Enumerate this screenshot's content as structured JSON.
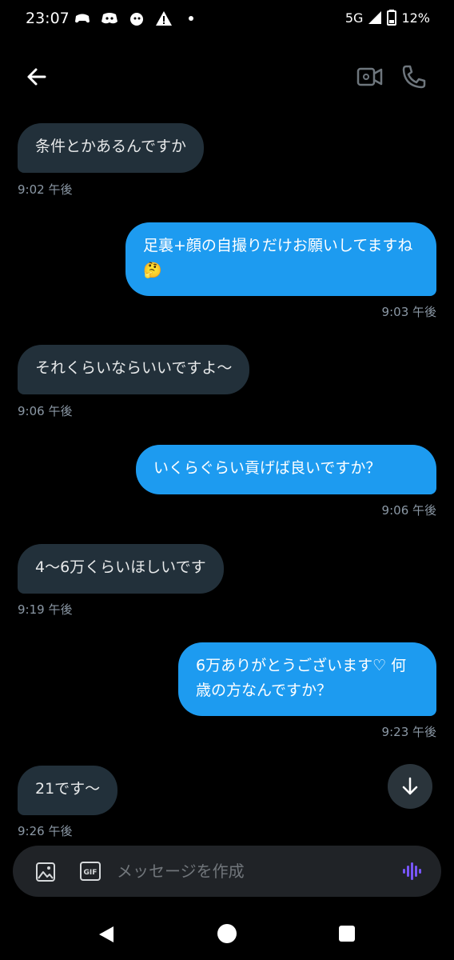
{
  "status_bar": {
    "time": "23:07",
    "network": "5G",
    "battery": "12%"
  },
  "messages": [
    {
      "direction": "in",
      "text": "条件とかあるんですか",
      "time": "9:02 午後"
    },
    {
      "direction": "out",
      "text": "足裏+顔の自撮りだけお願いしてますね🤔",
      "time": "9:03 午後"
    },
    {
      "direction": "in",
      "text": "それくらいならいいですよ〜",
      "time": "9:06 午後"
    },
    {
      "direction": "out",
      "text": "いくらぐらい貢げば良いですか？",
      "time": "9:06 午後"
    },
    {
      "direction": "in",
      "text": "4〜6万くらいほしいです",
      "time": "9:19 午後"
    },
    {
      "direction": "out",
      "text": "6万ありがとうございます♡ 何歳の方なんですか？",
      "time": "9:23 午後"
    },
    {
      "direction": "in",
      "text": "21です〜",
      "time": "9:26 午後"
    }
  ],
  "composer": {
    "placeholder": "メッセージを作成",
    "gif_label": "GIF"
  },
  "colors": {
    "background": "#000000",
    "incoming_bubble": "#22303a",
    "outgoing_bubble": "#1d9bf0",
    "timestamp": "#8b98a5",
    "voice_accent": "#7856ff"
  },
  "icons": [
    "back-arrow-icon",
    "video-call-icon",
    "phone-call-icon",
    "image-icon",
    "gif-icon",
    "voice-wave-icon",
    "arrow-down-icon"
  ]
}
